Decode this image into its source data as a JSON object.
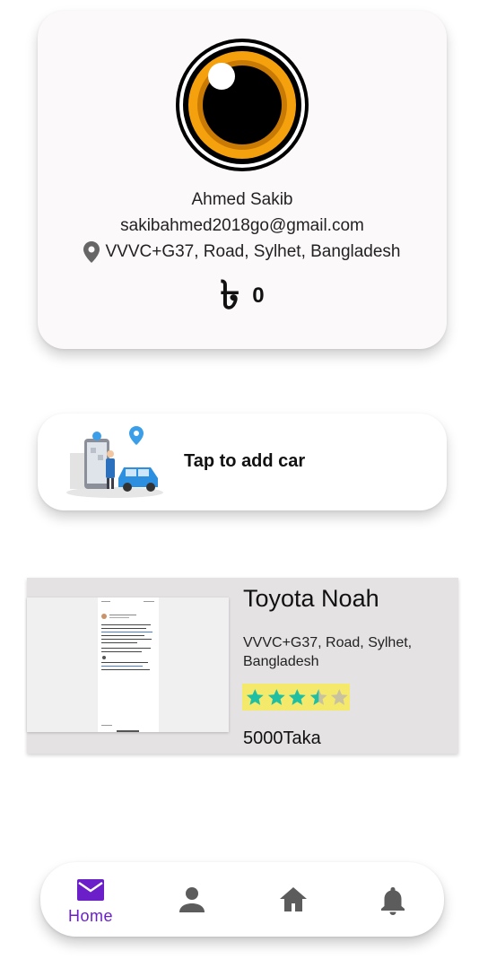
{
  "profile": {
    "name": "Ahmed Sakib",
    "email": "sakibahmed2018go@gmail.com",
    "address": "VVVC+G37, Road, Sylhet, Bangladesh",
    "currency_symbol": "৳",
    "balance": "0",
    "avatar_icon": "eye-avatar-icon"
  },
  "add_car": {
    "label": "Tap to add car",
    "illustration_icon": "car-location-illustration"
  },
  "listing": {
    "title": "Toyota Noah",
    "address": "VVVC+G37, Road, Sylhet, Bangladesh",
    "rating": 3.5,
    "rating_max": 5,
    "price": "5000Taka"
  },
  "nav": {
    "items": [
      {
        "label": "Home",
        "icon": "mail-icon",
        "active": true
      },
      {
        "label": "",
        "icon": "person-icon",
        "active": false
      },
      {
        "label": "",
        "icon": "home-icon",
        "active": false
      },
      {
        "label": "",
        "icon": "bell-icon",
        "active": false
      }
    ]
  },
  "colors": {
    "accent": "#6a1fc9",
    "star_filled": "#1fbfa4",
    "star_empty": "#c9c2a0",
    "rating_bg": "#f4e96a",
    "avatar_orange": "#f5a00d",
    "nav_icon_gray": "#5c5c5c"
  }
}
